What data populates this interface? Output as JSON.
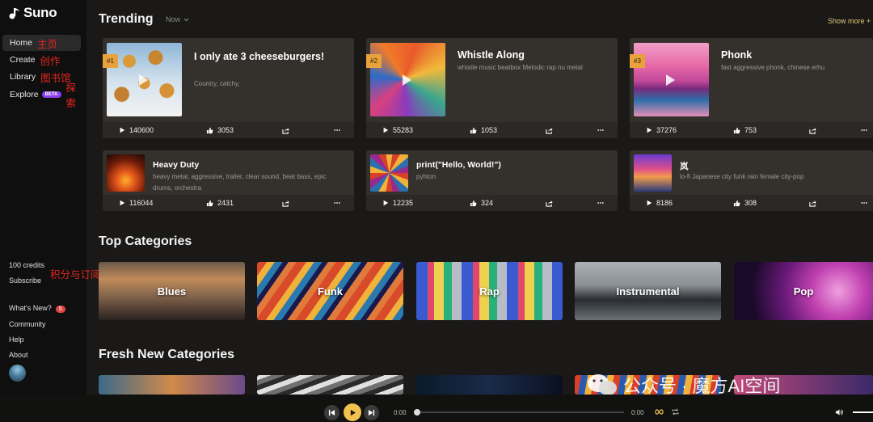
{
  "app": {
    "name": "Suno"
  },
  "sidebar": {
    "items": [
      {
        "label": "Home",
        "note": "主页"
      },
      {
        "label": "Create",
        "note": "创作"
      },
      {
        "label": "Library",
        "note": "图书馆"
      },
      {
        "label": "Explore",
        "badge": "BETA",
        "note": "探索"
      }
    ],
    "credits": "100 credits",
    "subscribe": "Subscribe",
    "credits_note": "积分与订阅",
    "whats_new": "What's New?",
    "whats_new_count": "5",
    "community": "Community",
    "help": "Help",
    "about": "About"
  },
  "trending": {
    "title": "Trending",
    "filter": "Now",
    "show_more": "Show more +",
    "cards": [
      {
        "rank": "#1",
        "title": "I only ate 3 cheeseburgers!",
        "tags": "Country, catchy,",
        "plays": "140600",
        "likes": "3053"
      },
      {
        "rank": "#2",
        "title": "Whistle Along",
        "tags": "whistle music beatbox Melodic rap nu metal",
        "plays": "55283",
        "likes": "1053"
      },
      {
        "rank": "#3",
        "title": "Phonk",
        "tags": "fast aggressive phonk, chinese erhu",
        "plays": "37276",
        "likes": "753"
      },
      {
        "title": "Heavy Duty",
        "tags": "heavy metal, aggressive, trailer, clear sound, beat bass, epic drums, orchestra",
        "plays": "116044",
        "likes": "2431"
      },
      {
        "title": "print(\"Hello, World!\")",
        "tags": "pyhton",
        "plays": "12235",
        "likes": "324"
      },
      {
        "title": "岚",
        "tags": "lo-fi Japanese city funk rain female city-pop",
        "plays": "8186",
        "likes": "308"
      }
    ]
  },
  "top_categories": {
    "title": "Top Categories",
    "items": [
      "Blues",
      "Funk",
      "Rap",
      "Instrumental",
      "Pop"
    ]
  },
  "fresh_categories": {
    "title": "Fresh New Categories"
  },
  "player": {
    "current_time": "0:00",
    "total_time": "0:00",
    "progress": 0
  },
  "watermark": "公众号 · 魔方AI空间"
}
